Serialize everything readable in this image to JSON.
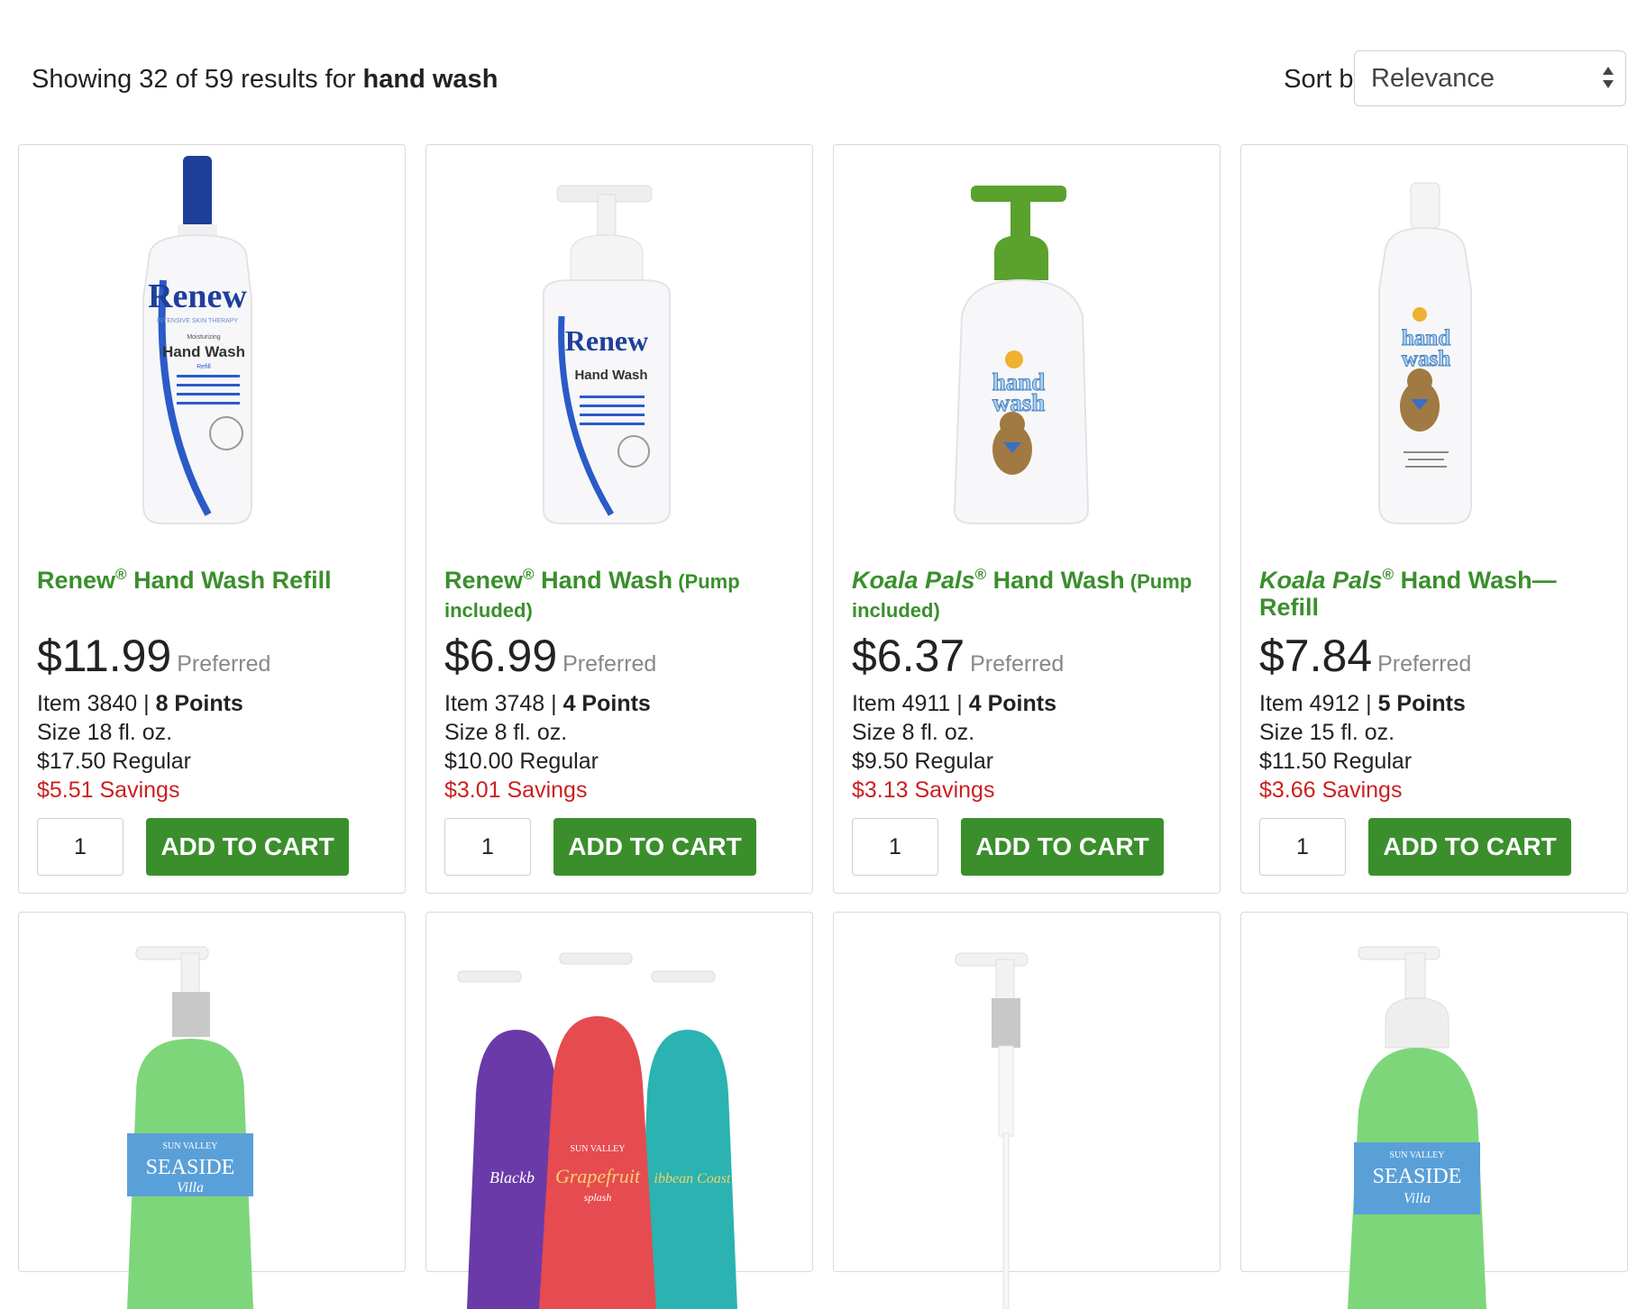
{
  "search": {
    "summary_prefix": "Showing 32 of 59 results for",
    "query": "hand wash",
    "sort_label": "Sort by",
    "sort_value": "Relevance"
  },
  "products": [
    {
      "brand": "Renew",
      "brand_italic": false,
      "reg_mark": "®",
      "name": " Hand Wash Refill",
      "extra": "",
      "price": "$11.99",
      "price_label": "Preferred",
      "item_prefix": "Item 3840 |",
      "points": "8 Points",
      "size": "Size 18 fl. oz.",
      "regular": "$17.50 Regular",
      "savings": "$5.51 Savings",
      "qty": "1",
      "cta": "ADD TO CART",
      "colors": {
        "accent": "#2244aa",
        "cap": "#1e3f9a"
      }
    },
    {
      "brand": "Renew",
      "brand_italic": false,
      "reg_mark": "®",
      "name": " Hand Wash",
      "extra": " (Pump included)",
      "price": "$6.99",
      "price_label": "Preferred",
      "item_prefix": "Item 3748 |",
      "points": "4 Points",
      "size": "Size 8 fl. oz.",
      "regular": "$10.00 Regular",
      "savings": "$3.01 Savings",
      "qty": "1",
      "cta": "ADD TO CART",
      "colors": {
        "accent": "#2244aa",
        "cap": "#eeeeee"
      }
    },
    {
      "brand": "Koala Pals",
      "brand_italic": true,
      "reg_mark": "®",
      "name": " Hand Wash",
      "extra": " (Pump included)",
      "price": "$6.37",
      "price_label": "Preferred",
      "item_prefix": "Item 4911 |",
      "points": "4 Points",
      "size": "Size 8 fl. oz.",
      "regular": "$9.50 Regular",
      "savings": "$3.13 Savings",
      "qty": "1",
      "cta": "ADD TO CART",
      "colors": {
        "accent": "#5a9cd8",
        "cap": "#5aa12e"
      }
    },
    {
      "brand": "Koala Pals",
      "brand_italic": true,
      "reg_mark": "®",
      "name": " Hand Wash—Refill",
      "extra": "",
      "price": "$7.84",
      "price_label": "Preferred",
      "item_prefix": "Item 4912 |",
      "points": "5 Points",
      "size": "Size 15 fl. oz.",
      "regular": "$11.50 Regular",
      "savings": "$3.66 Savings",
      "qty": "1",
      "cta": "ADD TO CART",
      "colors": {
        "accent": "#5a9cd8",
        "cap": "#f4f4f4"
      }
    }
  ],
  "row2_images": [
    {
      "label_top": "SUN VALLEY",
      "label_main": "SEASIDE",
      "label_sub": "Villa",
      "colors": {
        "body": "#7ed67a"
      }
    },
    {
      "label_top": "SUN VALLEY",
      "label_main": "Grapefruit",
      "label_sub": "splash",
      "colors": {
        "body": "#e64b50"
      }
    },
    {
      "label_top": "",
      "label_main": "",
      "label_sub": "",
      "colors": {
        "body": "#ffffff"
      }
    },
    {
      "label_top": "SUN VALLEY",
      "label_main": "SEASIDE",
      "label_sub": "Villa",
      "colors": {
        "body": "#7ed67a"
      }
    }
  ],
  "row2_image_labels": {
    "left_bottle": "Blackb",
    "right_bottle": "ibbean Coast"
  },
  "product_image_labels": {
    "renew_brand": "Renew",
    "renew_tag": "INTENSIVE SKIN THERAPY",
    "renew_sub": "Moisturizing",
    "renew_name": "Hand Wash",
    "renew_refill": "Refill",
    "koala_line1": "hand",
    "koala_line2": "wash"
  }
}
